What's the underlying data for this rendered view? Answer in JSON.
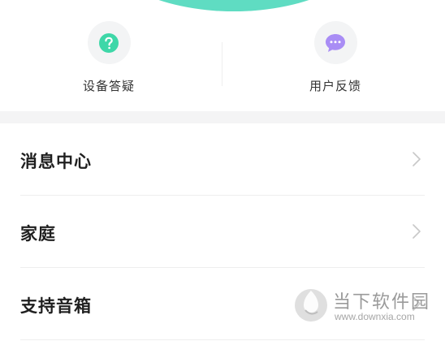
{
  "shortcuts": {
    "device_qa": {
      "label": "设备答疑",
      "icon": "question-circle-icon",
      "color": "#3ed7a8"
    },
    "user_feedback": {
      "label": "用户反馈",
      "icon": "chat-bubble-icon",
      "color": "#a98df5"
    }
  },
  "menu": {
    "items": [
      {
        "label": "消息中心"
      },
      {
        "label": "家庭"
      },
      {
        "label": "支持音箱"
      }
    ]
  },
  "watermark": {
    "text": "当下软件园",
    "url": "www.downxia.com"
  },
  "colors": {
    "accent_arc": "#5fdcc2",
    "section_gap": "#f4f4f5"
  }
}
